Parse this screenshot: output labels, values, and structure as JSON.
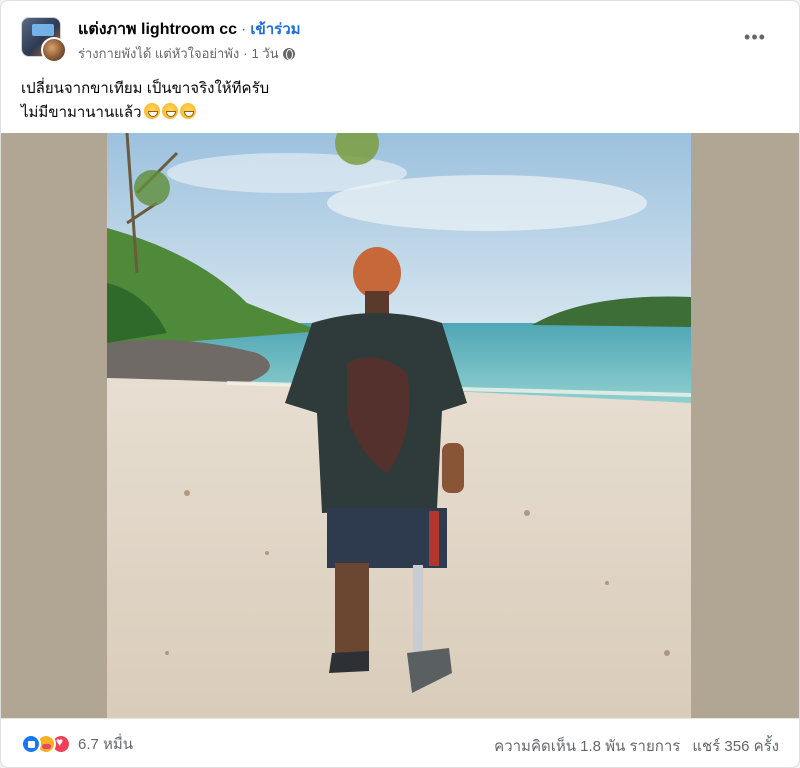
{
  "post": {
    "group_name": "แต่งภาพ lightroom cc",
    "separator": "·",
    "join_label": "เข้าร่วม",
    "author_name": "ร่างกายพังได้ แต่หัวใจอย่าพัง",
    "time": "1 วัน",
    "privacy_icon": "globe-icon",
    "more_icon": "•••",
    "caption_line1": "เปลี่ยนจากขาเทียม เป็นขาจริงให้ทีครับ",
    "caption_line2": "ไม่มีขามานานแล้ว"
  },
  "footer": {
    "reactions": [
      "like",
      "care",
      "love"
    ],
    "reaction_count": "6.7 หมื่น",
    "comments": "ความคิดเห็น 1.8 พัน รายการ",
    "shares": "แชร์ 356 ครั้ง"
  },
  "colors": {
    "accent": "#216fdb",
    "secondary_text": "#65676b",
    "media_background": "#b1a693"
  }
}
